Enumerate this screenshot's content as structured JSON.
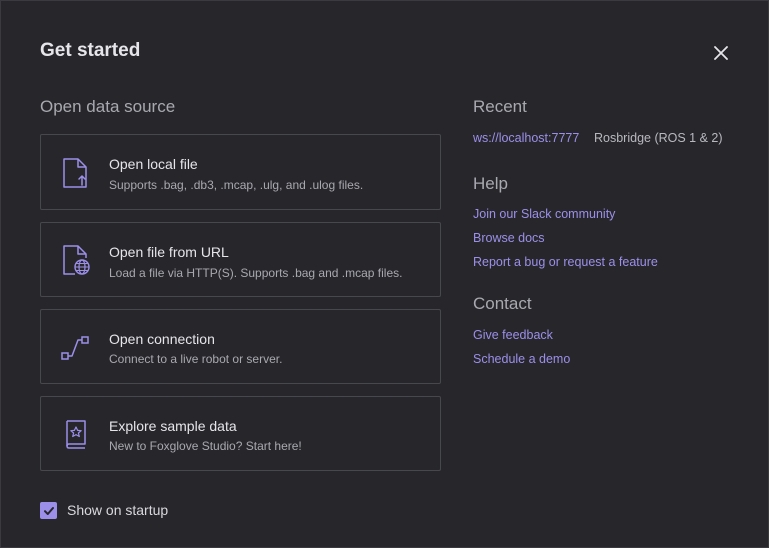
{
  "dialog": {
    "title": "Get started",
    "close_icon": "close-icon"
  },
  "open_data_source": {
    "heading": "Open data source",
    "cards": [
      {
        "icon": "file-upload-icon",
        "title": "Open local file",
        "description": "Supports .bag, .db3, .mcap, .ulg, and .ulog files."
      },
      {
        "icon": "file-globe-icon",
        "title": "Open file from URL",
        "description": "Load a file via HTTP(S). Supports .bag and .mcap files."
      },
      {
        "icon": "connection-icon",
        "title": "Open connection",
        "description": "Connect to a live robot or server."
      },
      {
        "icon": "sample-book-icon",
        "title": "Explore sample data",
        "description": "New to Foxglove Studio? Start here!"
      }
    ]
  },
  "recent": {
    "heading": "Recent",
    "items": [
      {
        "link": "ws://localhost:7777",
        "description": "Rosbridge (ROS 1 & 2)"
      }
    ]
  },
  "help": {
    "heading": "Help",
    "links": [
      "Join our Slack community",
      "Browse docs",
      "Report a bug or request a feature"
    ]
  },
  "contact": {
    "heading": "Contact",
    "links": [
      "Give feedback",
      "Schedule a demo"
    ]
  },
  "startup": {
    "label": "Show on startup",
    "checked": true
  },
  "colors": {
    "accent": "#9c8fea",
    "background": "#27272b",
    "card_border": "#47474e",
    "text_primary": "#e6e6ea",
    "text_secondary": "#a8a8b0"
  }
}
